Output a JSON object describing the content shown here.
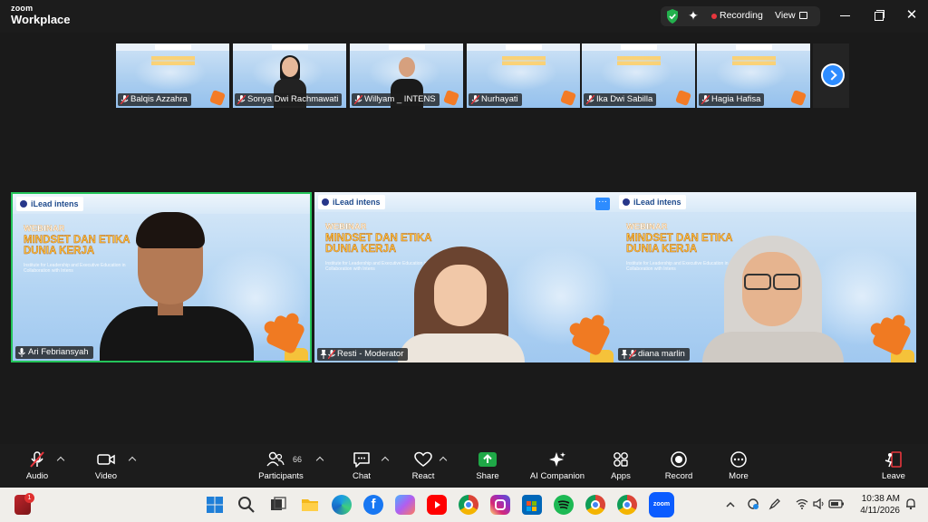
{
  "app": {
    "brand_top": "zoom",
    "brand_bottom": "Workplace"
  },
  "top_controls": {
    "recording_label": "Recording",
    "view_label": "View"
  },
  "thumbnails": [
    {
      "name": "Balqis Azzahra",
      "video": false
    },
    {
      "name": "Sonya Dwi Rachmawati",
      "video": true
    },
    {
      "name": "Willyam _ INTENS",
      "video": true
    },
    {
      "name": "Nurhayati",
      "video": false
    },
    {
      "name": "Ika Dwi Sabilla",
      "video": false
    },
    {
      "name": "Hagia Hafisa",
      "video": false
    }
  ],
  "tiles": [
    {
      "name": "Ari Febriansyah",
      "webinar": "WEBINAR",
      "title": "MINDSET DAN ETIKA DUNIA KERJA",
      "subtitle": "Institute for Leadership and Executive Education in Collaboration with Intens",
      "logo": "iLead intens",
      "speaking": true
    },
    {
      "name": "Resti - Moderator",
      "webinar": "WEBINAR",
      "title": "MINDSET DAN ETIKA DUNIA KERJA",
      "subtitle": "Institute for Leadership and Executive Education in Collaboration with Intens",
      "logo": "iLead intens",
      "more": "···"
    },
    {
      "name": "diana marlin",
      "webinar": "WEBINAR",
      "title": "MINDSET DAN ETIKA DUNIA KERJA",
      "subtitle": "Institute for Leadership and Executive Education in Collaboration with Intens",
      "logo": "iLead intens"
    }
  ],
  "toolbar": {
    "audio": "Audio",
    "video": "Video",
    "participants": "Participants",
    "participants_count": "66",
    "chat": "Chat",
    "react": "React",
    "share": "Share",
    "ai_companion": "AI Companion",
    "apps": "Apps",
    "record": "Record",
    "more": "More",
    "leave": "Leave"
  },
  "taskbar": {
    "time": "10:38 AM",
    "date": "4/11/2026",
    "notification_badge": "1",
    "zoom_label": "zoom",
    "apps": [
      "windows-start",
      "search",
      "task-view",
      "file-explorer",
      "edge",
      "facebook",
      "copilot",
      "youtube",
      "chrome",
      "instagram",
      "store",
      "spotify",
      "chrome-profile-1",
      "chrome-profile-2",
      "zoom"
    ]
  },
  "colors": {
    "accent": "#2d8cff",
    "active_speaker": "#24c45a",
    "recording_dot": "#e8363d",
    "share_green": "#1fa847",
    "leave_red": "#e8363d",
    "toolbar_bg": "#1c1c1c"
  }
}
